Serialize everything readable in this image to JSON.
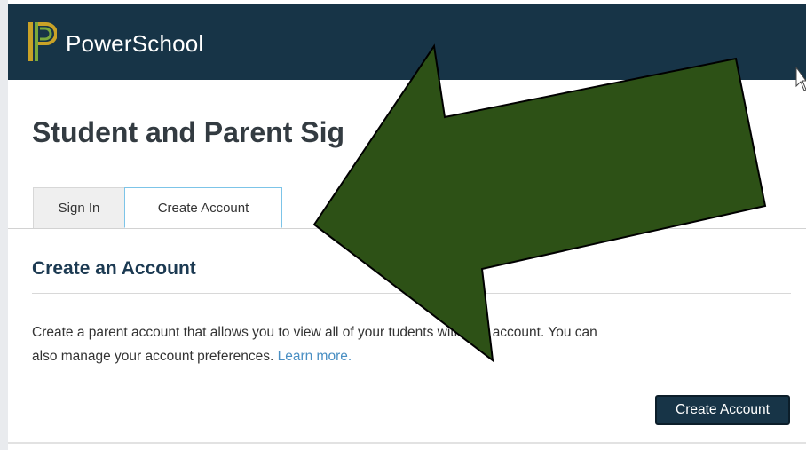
{
  "header": {
    "brand": "PowerSchool",
    "logo_icon": "powerschool-logo-icon",
    "background": "#173447"
  },
  "page_title": "Student and Parent Sig",
  "tabs": [
    {
      "label": "Sign In",
      "active": false
    },
    {
      "label": "Create Account",
      "active": true
    }
  ],
  "section": {
    "title": "Create an Account",
    "description_part1": "Create a parent account that allows you to view all of your",
    "description_part2": "tudents with one account. You can",
    "description_part3": "also manage your account preferences.",
    "learn_more": "Learn more."
  },
  "create_button": {
    "label": "Create Account"
  },
  "overlay": {
    "icon": "green-arrow-annotation-icon",
    "color": "#2d5116"
  },
  "colors": {
    "accent": "#173447",
    "link": "#4a8fc3",
    "active_tab_border": "#7cc4e8"
  }
}
